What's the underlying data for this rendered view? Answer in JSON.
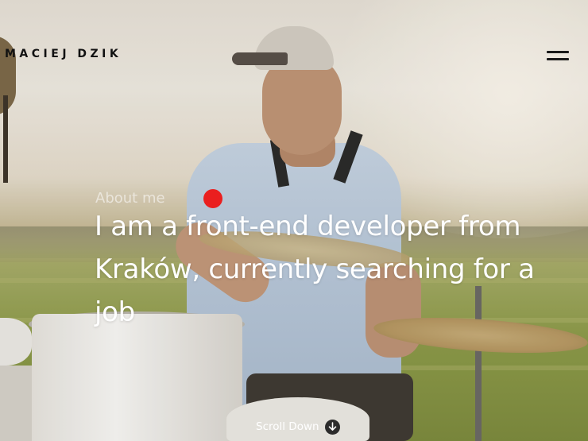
{
  "header": {
    "brand": "MACIEJ DZIK",
    "menu_icon": "hamburger-menu-icon"
  },
  "hero": {
    "section_label": "About me",
    "headline": "I am a front-end developer from Kraków, currently searching for a job",
    "accent_color": "#ea1f1f"
  },
  "scroll": {
    "label": "Scroll Down",
    "icon": "arrow-down-circle-icon"
  }
}
